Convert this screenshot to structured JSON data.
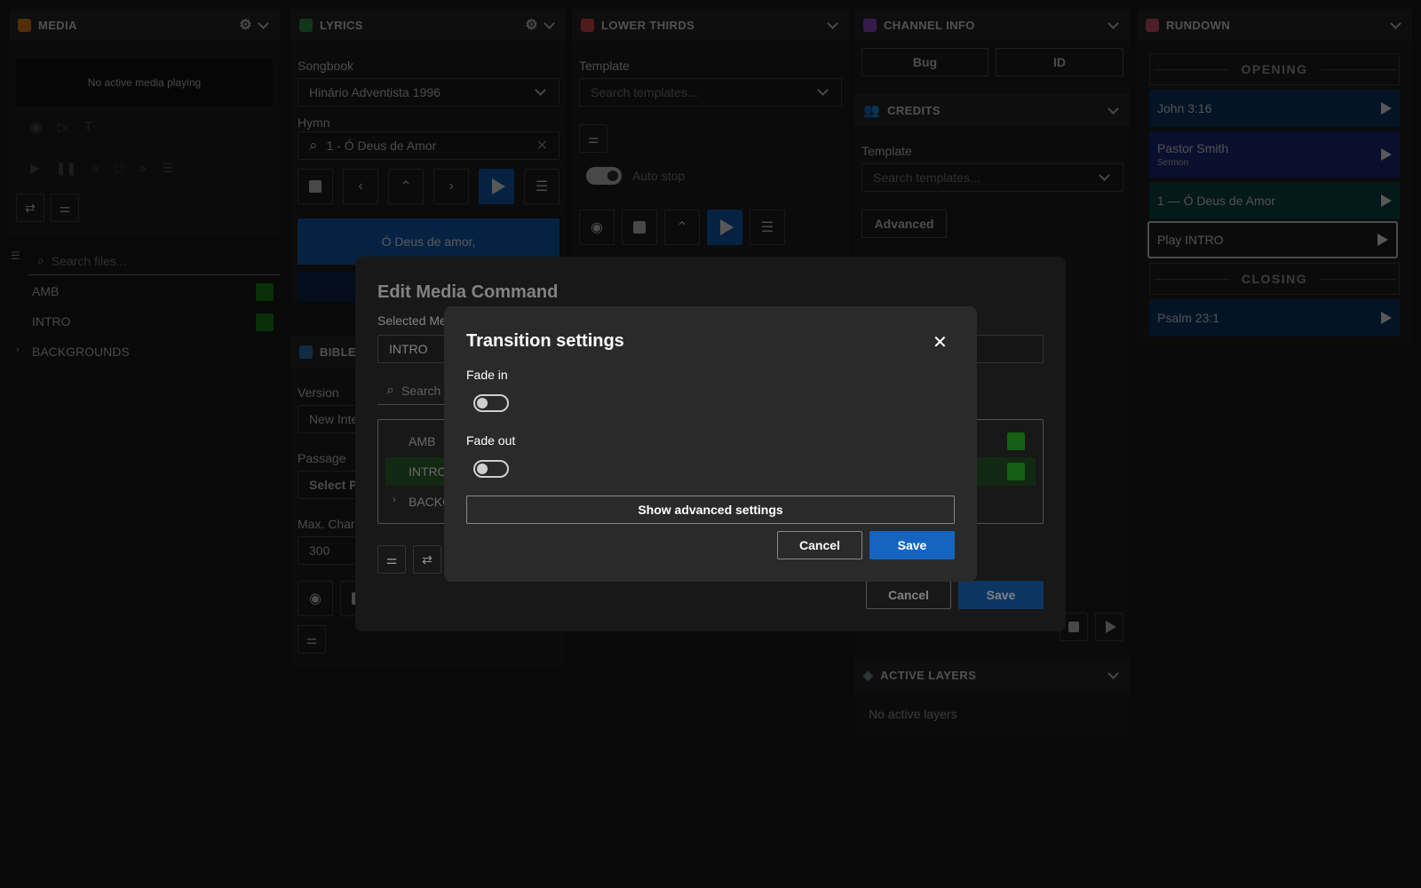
{
  "colors": {
    "media": "#e8891e",
    "lyrics": "#2e9e4c",
    "lower": "#e24e4e",
    "channel": "#9c4fd6",
    "rundown": "#e0557a",
    "accent": "#1565c0"
  },
  "media": {
    "title": "MEDIA",
    "status": "No active media playing",
    "search_placeholder": "Search files...",
    "files": [
      {
        "name": "AMB"
      },
      {
        "name": "INTRO"
      },
      {
        "name": "BACKGROUNDS"
      }
    ]
  },
  "lyrics": {
    "title": "LYRICS",
    "songbook_label": "Songbook",
    "songbook_value": "Hinário Adventista 1996",
    "hymn_label": "Hymn",
    "hymn_value": "1 - Ó Deus de Amor",
    "preview_line": "Ó Deus de amor,"
  },
  "bible": {
    "title": "BIBLE",
    "version_label": "Version",
    "version_value": "New Inte",
    "passage_label": "Passage",
    "passage_value": "Select P",
    "maxchars_label": "Max. Char",
    "maxchars_value": "300"
  },
  "lower_thirds": {
    "title": "LOWER THIRDS",
    "template_label": "Template",
    "template_placeholder": "Search templates...",
    "autostop_label": "Auto stop"
  },
  "channel": {
    "title": "CHANNEL INFO",
    "bug_label": "Bug",
    "id_label": "ID"
  },
  "credits": {
    "title": "CREDITS",
    "template_label": "Template",
    "template_placeholder": "Search templates...",
    "advanced_label": "Advanced"
  },
  "active_layers": {
    "title": "ACTIVE LAYERS",
    "empty": "No active layers"
  },
  "rundown": {
    "title": "RUNDOWN",
    "section_opening": "OPENING",
    "section_closing": "CLOSING",
    "items": [
      {
        "title": "John 3:16",
        "color": "#0d3d6e"
      },
      {
        "title": "Pastor Smith",
        "subtitle": "Sermon",
        "color": "#1f2d8a"
      },
      {
        "title": "1 — Ó Deus de Amor",
        "color": "#0d4a48"
      },
      {
        "title": "Play INTRO",
        "color": "#232323"
      },
      {
        "title": "Psalm 23:1",
        "color": "#0d3d6e"
      }
    ]
  },
  "edit_dialog": {
    "title": "Edit Media Command",
    "selected_label": "Selected Me",
    "selected_value": "INTRO",
    "search_placeholder": "Search",
    "list": [
      "AMB",
      "INTRO",
      "BACKG"
    ],
    "cancel": "Cancel",
    "save": "Save"
  },
  "transition_dialog": {
    "title": "Transition settings",
    "fade_in_label": "Fade in",
    "fade_out_label": "Fade out",
    "advanced_button": "Show advanced settings",
    "cancel": "Cancel",
    "save": "Save"
  }
}
